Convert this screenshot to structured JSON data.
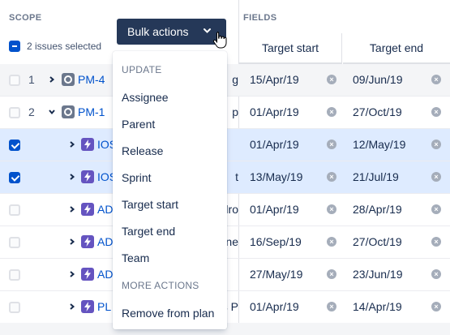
{
  "header": {
    "scope_label": "SCOPE",
    "fields_label": "FIELDS",
    "selected_count_text": "2 issues selected",
    "columns": [
      "Target start",
      "Target end"
    ]
  },
  "bulk_actions": {
    "label": "Bulk actions",
    "caret_icon": "chevron-down-icon",
    "accent": "#253858"
  },
  "menu": {
    "update_title": "UPDATE",
    "update_items": [
      "Assignee",
      "Parent",
      "Release",
      "Sprint",
      "Target start",
      "Target end",
      "Team"
    ],
    "more_title": "MORE ACTIONS",
    "more_items": [
      "Remove from plan"
    ]
  },
  "rows": [
    {
      "num": "1",
      "checked": false,
      "expanded": false,
      "icon": "project",
      "key": "PM-4",
      "tail": "g",
      "start": "15/Apr/19",
      "end": "09/Jun/19",
      "style": "group"
    },
    {
      "num": "2",
      "checked": false,
      "expanded": true,
      "icon": "project",
      "key": "PM-1",
      "tail": "p",
      "start": "01/Apr/19",
      "end": "27/Oct/19",
      "style": "normal"
    },
    {
      "num": "",
      "checked": true,
      "expanded": false,
      "icon": "story",
      "key": "IOS",
      "tail": "",
      "start": "01/Apr/19",
      "end": "12/May/19",
      "style": "selected"
    },
    {
      "num": "",
      "checked": true,
      "expanded": false,
      "icon": "story",
      "key": "IOS",
      "tail": "t",
      "start": "13/May/19",
      "end": "21/Jul/19",
      "style": "selected"
    },
    {
      "num": "",
      "checked": false,
      "expanded": false,
      "icon": "story",
      "key": "AD",
      "tail": "dro",
      "start": "01/Apr/19",
      "end": "28/Apr/19",
      "style": "normal"
    },
    {
      "num": "",
      "checked": false,
      "expanded": false,
      "icon": "story",
      "key": "AD",
      "tail": "ne",
      "start": "16/Sep/19",
      "end": "27/Oct/19",
      "style": "normal"
    },
    {
      "num": "",
      "checked": false,
      "expanded": false,
      "icon": "story",
      "key": "AD",
      "tail": "",
      "start": "27/May/19",
      "end": "23/Jun/19",
      "style": "normal"
    },
    {
      "num": "",
      "checked": false,
      "expanded": false,
      "icon": "story",
      "key": "PL",
      "tail": "s P",
      "start": "01/Apr/19",
      "end": "14/Apr/19",
      "style": "normal"
    }
  ],
  "colors": {
    "primary": "#0052cc",
    "selected_row": "#deebff",
    "group_row": "#f4f5f7",
    "story_icon": "#6554c0",
    "project_icon": "#6b778c"
  }
}
